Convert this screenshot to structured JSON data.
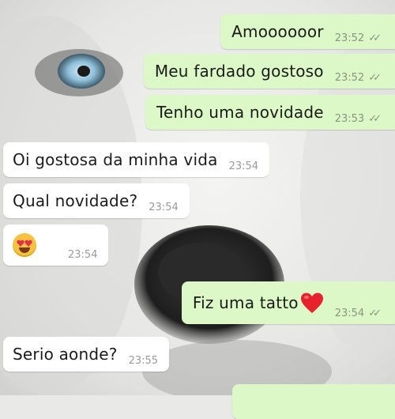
{
  "messages": [
    {
      "text": "Amoooooor",
      "time": "23:52",
      "direction": "outgoing",
      "status": "read-double-check"
    },
    {
      "text": "Meu fardado gostoso",
      "time": "23:52",
      "direction": "outgoing",
      "status": "read-double-check"
    },
    {
      "text": "Tenho uma novidade",
      "time": "23:53",
      "direction": "outgoing",
      "status": "read-double-check"
    },
    {
      "text": "Oi gostosa da minha vida",
      "time": "23:54",
      "direction": "incoming"
    },
    {
      "text": "Qual novidade?",
      "time": "23:54",
      "direction": "incoming"
    },
    {
      "text": "",
      "emoji": "heart-eyes-emoji",
      "time": "23:54",
      "direction": "incoming"
    },
    {
      "text": "Fiz uma tatto",
      "emoji": "red-heart-emoji",
      "time": "23:54",
      "direction": "outgoing",
      "status": "read-double-check"
    },
    {
      "text": "Serio aonde?",
      "time": "23:55",
      "direction": "incoming"
    }
  ],
  "ticks_glyph": "✓✓",
  "colors": {
    "outgoing_bubble": "#dcf8c6",
    "incoming_bubble": "#ffffff",
    "read_ticks": "#8a9483"
  },
  "wallpaper": "white-husky-dog-photo"
}
